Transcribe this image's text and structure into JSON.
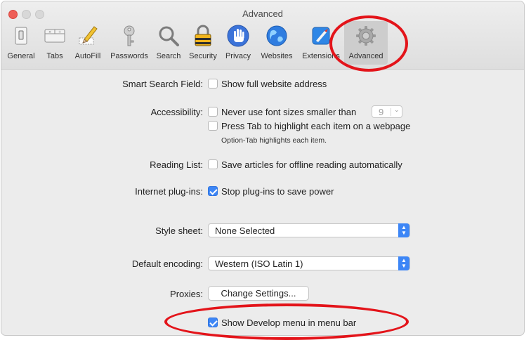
{
  "window": {
    "title": "Advanced"
  },
  "toolbar": {
    "items": [
      {
        "label": "General",
        "icon": "general-switch-icon"
      },
      {
        "label": "Tabs",
        "icon": "tabs-icon"
      },
      {
        "label": "AutoFill",
        "icon": "pencil-form-icon"
      },
      {
        "label": "Passwords",
        "icon": "key-icon"
      },
      {
        "label": "Search",
        "icon": "magnifier-icon"
      },
      {
        "label": "Security",
        "icon": "padlock-icon"
      },
      {
        "label": "Privacy",
        "icon": "hand-icon"
      },
      {
        "label": "Websites",
        "icon": "globe-icon"
      },
      {
        "label": "Extensions",
        "icon": "puzzle-extension-icon"
      },
      {
        "label": "Advanced",
        "icon": "gear-icon"
      }
    ]
  },
  "settings": {
    "smart_search": {
      "label": "Smart Search Field:",
      "option": "Show full website address",
      "checked": false
    },
    "accessibility": {
      "label": "Accessibility:",
      "font_option": "Never use font sizes smaller than",
      "font_size": "9",
      "tab_option": "Press Tab to highlight each item on a webpage",
      "tab_note": "Option-Tab highlights each item."
    },
    "reading_list": {
      "label": "Reading List:",
      "option": "Save articles for offline reading automatically"
    },
    "plugins": {
      "label": "Internet plug-ins:",
      "option": "Stop plug-ins to save power",
      "checked": true
    },
    "style_sheet": {
      "label": "Style sheet:",
      "value": "None Selected"
    },
    "encoding": {
      "label": "Default encoding:",
      "value": "Western (ISO Latin 1)"
    },
    "proxies": {
      "label": "Proxies:",
      "button": "Change Settings..."
    },
    "develop": {
      "option": "Show Develop menu in menu bar",
      "checked": true
    }
  },
  "colors": {
    "highlight_circle": "#e3141a",
    "accent": "#3d86f6"
  }
}
